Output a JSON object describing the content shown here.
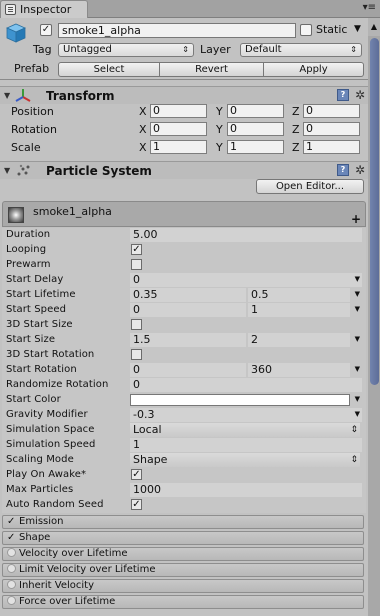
{
  "tab": {
    "title": "Inspector"
  },
  "header": {
    "name": "smoke1_alpha",
    "static_label": "Static",
    "tag_label": "Tag",
    "tag_value": "Untagged",
    "layer_label": "Layer",
    "layer_value": "Default",
    "prefab_label": "Prefab",
    "select": "Select",
    "revert": "Revert",
    "apply": "Apply"
  },
  "transform": {
    "title": "Transform",
    "rows": [
      {
        "label": "Position",
        "x": "0",
        "y": "0",
        "z": "0"
      },
      {
        "label": "Rotation",
        "x": "0",
        "y": "0",
        "z": "0"
      },
      {
        "label": "Scale",
        "x": "1",
        "y": "1",
        "z": "1"
      }
    ]
  },
  "particle": {
    "title": "Particle System",
    "open_editor": "Open Editor...",
    "system_name": "smoke1_alpha",
    "duration_label": "Duration",
    "duration": "5.00",
    "looping_label": "Looping",
    "prewarm_label": "Prewarm",
    "start_delay_label": "Start Delay",
    "start_delay": "0",
    "start_lifetime_label": "Start Lifetime",
    "start_lifetime_min": "0.35",
    "start_lifetime_max": "0.5",
    "start_speed_label": "Start Speed",
    "start_speed_min": "0",
    "start_speed_max": "1",
    "start_size_3d_label": "3D Start Size",
    "start_size_label": "Start Size",
    "start_size_min": "1.5",
    "start_size_max": "2",
    "start_rotation_3d_label": "3D Start Rotation",
    "start_rotation_label": "Start Rotation",
    "start_rotation_min": "0",
    "start_rotation_max": "360",
    "randomize_rotation_label": "Randomize Rotation",
    "randomize_rotation": "0",
    "start_color_label": "Start Color",
    "start_color": "#ffffff",
    "gravity_label": "Gravity Modifier",
    "gravity": "-0.3",
    "sim_space_label": "Simulation Space",
    "sim_space": "Local",
    "sim_speed_label": "Simulation Speed",
    "sim_speed": "1",
    "scaling_label": "Scaling Mode",
    "scaling": "Shape",
    "play_on_awake_label": "Play On Awake*",
    "max_particles_label": "Max Particles",
    "max_particles": "1000",
    "auto_seed_label": "Auto Random Seed"
  },
  "modules": [
    {
      "label": "Emission",
      "enabled": true
    },
    {
      "label": "Shape",
      "enabled": true
    },
    {
      "label": "Velocity over Lifetime",
      "enabled": false
    },
    {
      "label": "Limit Velocity over Lifetime",
      "enabled": false
    },
    {
      "label": "Inherit Velocity",
      "enabled": false
    },
    {
      "label": "Force over Lifetime",
      "enabled": false
    }
  ],
  "glyphs": {
    "check": "✓",
    "fold_open": "▼",
    "dropdown": "▼",
    "updown": "⇕",
    "gear": "✲",
    "help": "?",
    "plus": "+",
    "menu": "▾≡"
  }
}
